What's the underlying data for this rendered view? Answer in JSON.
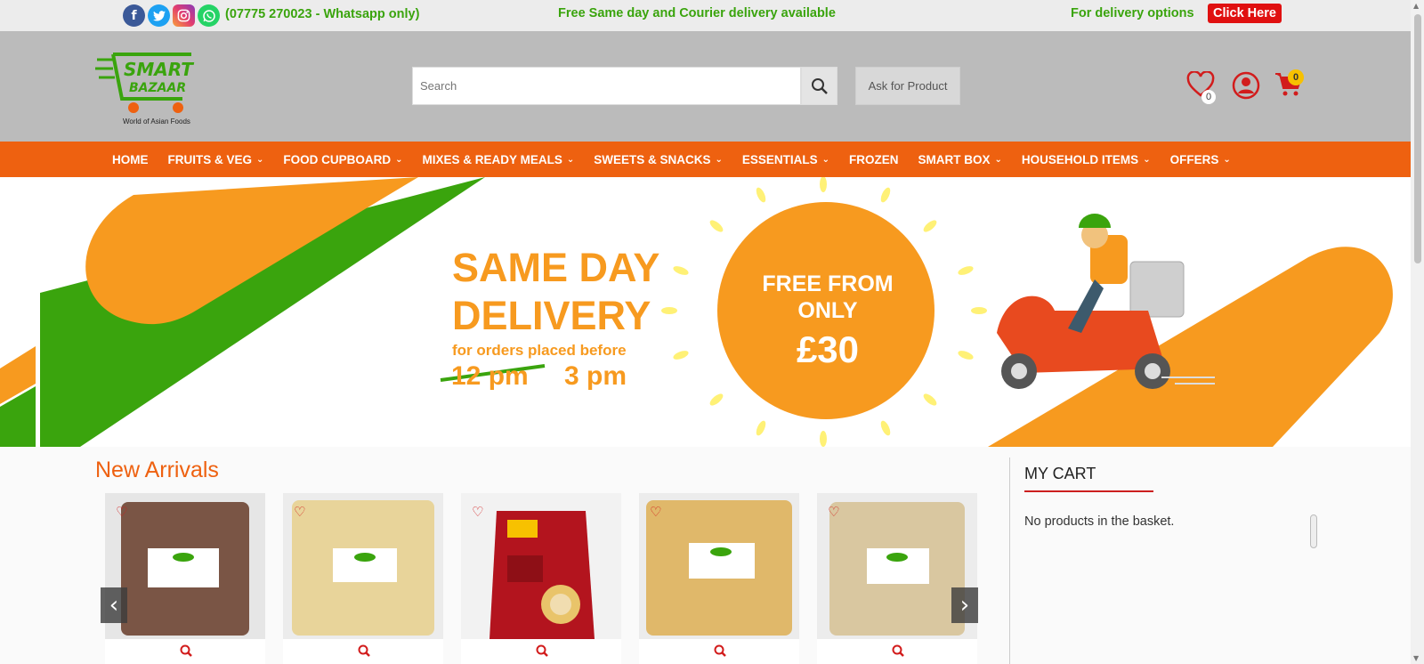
{
  "topbar": {
    "social_icons": [
      "facebook-icon",
      "twitter-icon",
      "instagram-icon",
      "whatsapp-icon"
    ],
    "phone": "(07775 270023 - Whatsapp only)",
    "message": "Free Same day and Courier delivery available",
    "delivery_options": "For delivery options",
    "click_here": "Click Here"
  },
  "header": {
    "search_placeholder": "Search",
    "ask_button": "Ask for Product",
    "wishlist_count": "0",
    "cart_count": "0"
  },
  "nav": {
    "items": [
      {
        "label": "HOME",
        "dropdown": false
      },
      {
        "label": "FRUITS & VEG",
        "dropdown": true
      },
      {
        "label": "FOOD CUPBOARD",
        "dropdown": true
      },
      {
        "label": "MIXES & READY MEALS",
        "dropdown": true
      },
      {
        "label": "SWEETS & SNACKS",
        "dropdown": true
      },
      {
        "label": "ESSENTIALS",
        "dropdown": true
      },
      {
        "label": "FROZEN",
        "dropdown": false
      },
      {
        "label": "SMART BOX",
        "dropdown": true
      },
      {
        "label": "HOUSEHOLD ITEMS",
        "dropdown": true
      },
      {
        "label": "OFFERS",
        "dropdown": true
      }
    ]
  },
  "banner": {
    "title_line1": "SAME DAY",
    "title_line2": "DELIVERY",
    "subtitle": "for orders placed before",
    "old_time": "12 pm",
    "new_time": "3 pm",
    "free_line1": "FREE FROM",
    "free_line2": "ONLY",
    "price": "£30"
  },
  "new_arrivals": {
    "title": "New Arrivals",
    "products": [
      {
        "image": "brown-lentil-pack"
      },
      {
        "image": "yellow-dal-pack"
      },
      {
        "image": "mtr-masala-rava-idli-pack"
      },
      {
        "image": "chana-dal-pack"
      },
      {
        "image": "white-grain-pack"
      }
    ]
  },
  "cart": {
    "title": "MY CART",
    "empty_text": "No products in the basket."
  },
  "colors": {
    "nav_orange": "#ee6110",
    "brand_green": "#3aa40d",
    "banner_orange": "#f79a1f",
    "accent_red": "#d21c1c"
  }
}
